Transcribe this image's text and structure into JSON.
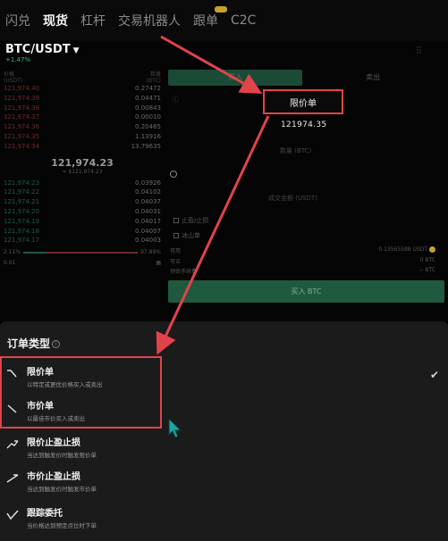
{
  "topnav": {
    "tabs": [
      {
        "label": "闪兑",
        "active": false
      },
      {
        "label": "现货",
        "active": true
      },
      {
        "label": "杠杆",
        "active": false
      },
      {
        "label": "交易机器人",
        "active": false
      },
      {
        "label": "跟单",
        "active": false,
        "badge": true
      },
      {
        "label": "C2C",
        "active": false
      }
    ]
  },
  "pair": {
    "symbol": "BTC/USDT",
    "change": "+1.47%"
  },
  "orderbook": {
    "header_price": "价格\n(USDT)",
    "header_qty": "数量\n(BTC)",
    "asks": [
      {
        "price": "121,974.40",
        "qty": "0.27472"
      },
      {
        "price": "121,974.39",
        "qty": "0.04471"
      },
      {
        "price": "121,974.38",
        "qty": "0.00843"
      },
      {
        "price": "121,974.37",
        "qty": "0.00010"
      },
      {
        "price": "121,974.36",
        "qty": "0.20465"
      },
      {
        "price": "121,974.35",
        "qty": "1.13916"
      },
      {
        "price": "121,974.34",
        "qty": "13.79635"
      }
    ],
    "last_price": "121,974.23",
    "last_fiat": "≈ $121,974.23",
    "bids": [
      {
        "price": "121,974.23",
        "qty": "0.03926"
      },
      {
        "price": "121,974.22",
        "qty": "0.04102"
      },
      {
        "price": "121,974.21",
        "qty": "0.04037"
      },
      {
        "price": "121,974.20",
        "qty": "0.04031"
      },
      {
        "price": "121,974.19",
        "qty": "0.04017"
      },
      {
        "price": "121,974.18",
        "qty": "0.04007"
      },
      {
        "price": "121,974.17",
        "qty": "0.04003"
      }
    ],
    "depth_left": "2.11%",
    "depth_right": "97.89%",
    "precision": "0.01"
  },
  "form": {
    "buy_label": "买入",
    "sell_label": "卖出",
    "order_type_selected": "限价单",
    "price_value": "121974.35",
    "qty_placeholder": "数量 (BTC)",
    "amount_placeholder": "成交金额 (USDT)",
    "tp_sl_label": "止盈/止损",
    "iceberg_label": "冰山单",
    "available_label": "可用",
    "available_value": "0.13565588 USDT",
    "max_buy_label": "可买",
    "max_buy_value": "0 BTC",
    "fee_label": "预估手续费",
    "fee_value": "-- BTC",
    "buy_button": "买入 BTC"
  },
  "sheet": {
    "title": "订单类型",
    "options": [
      {
        "name": "限价单",
        "desc": "以特定或更优价格买入或卖出",
        "selected": true,
        "icon": "limit-order-icon"
      },
      {
        "name": "市价单",
        "desc": "以最佳市价买入或卖出",
        "selected": false,
        "icon": "market-order-icon"
      },
      {
        "name": "限价止盈止损",
        "desc": "当达到触发价时触发限价单",
        "selected": false,
        "icon": "stop-limit-icon"
      },
      {
        "name": "市价止盈止损",
        "desc": "当达到触发价时触发市价单",
        "selected": false,
        "icon": "stop-market-icon"
      },
      {
        "name": "跟踪委托",
        "desc": "当价格达到预定点位时下单",
        "selected": false,
        "icon": "trailing-stop-icon"
      }
    ]
  },
  "colors": {
    "annotation": "#e1434b",
    "buy": "#2ebd85",
    "sell": "#f6465d",
    "sheet_bg": "#1b1b1b"
  }
}
